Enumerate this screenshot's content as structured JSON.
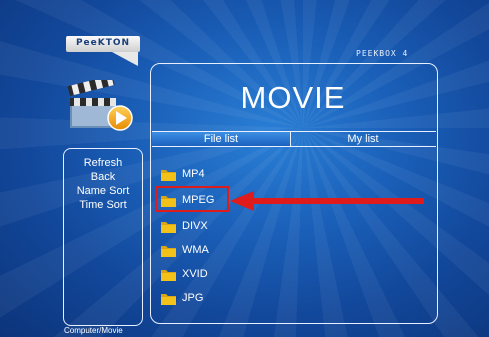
{
  "brand": {
    "logo_text": "PeeKTON",
    "model": "PEEKBOX 4"
  },
  "page": {
    "title": "MOVIE"
  },
  "tabs": {
    "file_list": "File list",
    "my_list": "My list"
  },
  "files": [
    {
      "name": "MP4",
      "icon": "folder-icon"
    },
    {
      "name": "MPEG",
      "icon": "folder-icon",
      "selected": true
    },
    {
      "name": "DIVX",
      "icon": "folder-icon"
    },
    {
      "name": "WMA",
      "icon": "folder-icon"
    },
    {
      "name": "XVID",
      "icon": "folder-icon"
    },
    {
      "name": "JPG",
      "icon": "folder-icon"
    }
  ],
  "side_menu": {
    "refresh": "Refresh",
    "back": "Back",
    "name_sort": "Name Sort",
    "time_sort": "Time Sort"
  },
  "status": {
    "path": "Computer/Movie"
  },
  "colors": {
    "background": "#1a5fb8",
    "accent_tab": "#2f7fd8",
    "highlight": "#e01b1b",
    "folder": "#f2c21b"
  }
}
